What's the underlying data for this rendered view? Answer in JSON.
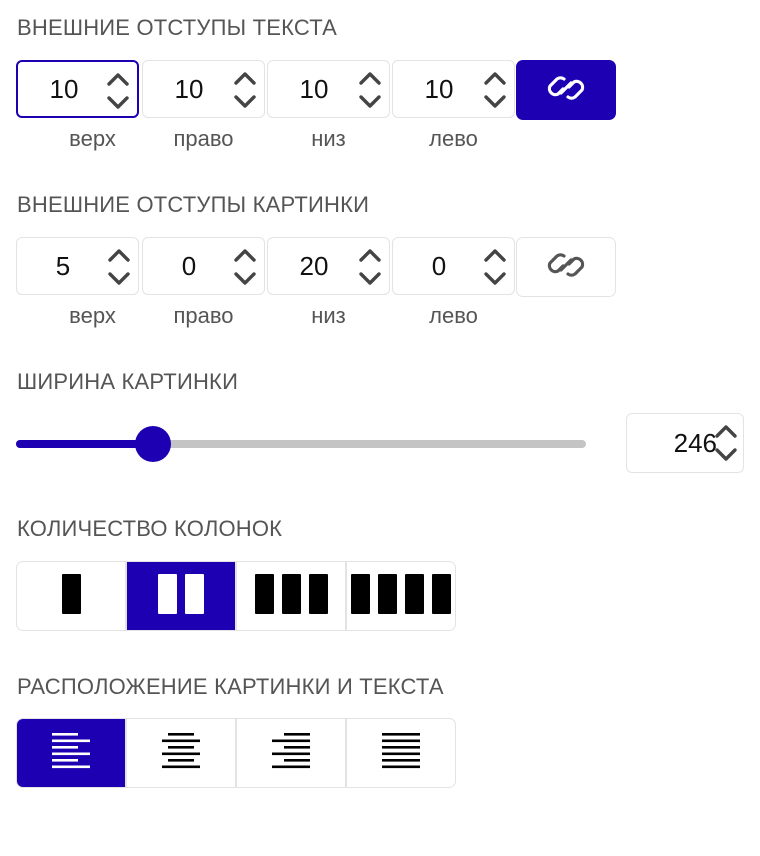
{
  "text_margins": {
    "title": "ВНЕШНИЕ ОТСТУПЫ ТЕКСТА",
    "fields": [
      {
        "value": "10",
        "label": "верх"
      },
      {
        "value": "10",
        "label": "право"
      },
      {
        "value": "10",
        "label": "низ"
      },
      {
        "value": "10",
        "label": "лево"
      }
    ],
    "link_active": true
  },
  "image_margins": {
    "title": "ВНЕШНИЕ ОТСТУПЫ КАРТИНКИ",
    "fields": [
      {
        "value": "5",
        "label": "верх"
      },
      {
        "value": "0",
        "label": "право"
      },
      {
        "value": "20",
        "label": "низ"
      },
      {
        "value": "0",
        "label": "лево"
      }
    ],
    "link_active": false
  },
  "image_width": {
    "title": "ШИРИНА КАРТИНКИ",
    "value": "246",
    "slider_fraction": 0.24
  },
  "columns": {
    "title": "КОЛИЧЕСТВО КОЛОНОК",
    "options": [
      {
        "icon": "one-column-icon",
        "count": 1
      },
      {
        "icon": "two-columns-icon",
        "count": 2
      },
      {
        "icon": "three-columns-icon",
        "count": 3
      },
      {
        "icon": "four-columns-icon",
        "count": 4
      }
    ],
    "selected": 1
  },
  "alignment": {
    "title": "РАСПОЛОЖЕНИЕ КАРТИНКИ И ТЕКСТА",
    "options": [
      {
        "icon": "align-left-icon"
      },
      {
        "icon": "align-center-icon"
      },
      {
        "icon": "align-right-icon"
      },
      {
        "icon": "align-justify-icon"
      }
    ],
    "selected": 0
  },
  "colors": {
    "accent": "#1c00b2",
    "border": "#e3e3e3",
    "label": "#555555",
    "track": "#c4c4c4"
  }
}
